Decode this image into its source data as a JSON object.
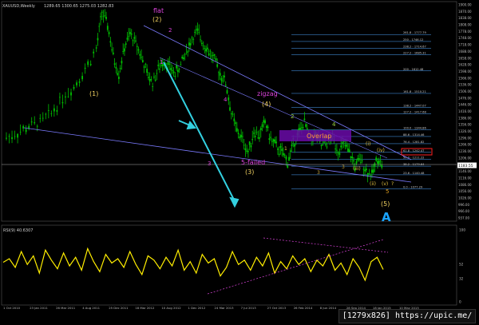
{
  "symbol": "XAUUSD,Weekly",
  "ohlc_text": "1289.65 1300.65 1275.03 1282.83",
  "indicator_label": "RSI(9) 40.6307",
  "watermark": "[1279x826] https://upic.me/",
  "colors": {
    "background": "#000000",
    "candle": "#00c000",
    "channel": "#7b7bff",
    "arrow": "#33d0e0",
    "wave_main": "#f0d060",
    "wave_sub": "#dd44dd",
    "overlap_box": "#6a0ba8",
    "rsi": "#ffee00",
    "fib_line": "#4da6ff",
    "highlight_box": "#ff2020",
    "level_A": "#1aa3ff"
  },
  "chart_data": {
    "type": "line",
    "title": "",
    "x_tick_labels": [
      "1 Oct 2010",
      "23 Jan 2011",
      "26 Mar 2011",
      "4 Aug 2011",
      "25 Dec 2011",
      "18 Mar 2012",
      "10 Aug 2012",
      "1 Dec 2012",
      "24 Mar 2013",
      "7 Jul 2013",
      "27 Oct 2013",
      "26 Feb 2014",
      "8 Jun 2014",
      "28 Sep 2014",
      "18 Jan 2015",
      "10 May 2015"
    ],
    "y_tick_labels": [
      "1900.00",
      "1870.00",
      "1838.00",
      "1808.00",
      "1778.00",
      "1748.00",
      "1718.00",
      "1688.00",
      "1658.00",
      "1628.00",
      "1598.00",
      "1566.00",
      "1536.00",
      "1506.00",
      "1476.00",
      "1446.00",
      "1416.00",
      "1386.00",
      "1356.00",
      "1326.00",
      "1296.00",
      "1266.00",
      "1236.00",
      "1206.00",
      "1176.00",
      "1146.00",
      "1116.00",
      "1086.00",
      "1056.00",
      "1026.00",
      "996.00",
      "966.00",
      "937.00"
    ],
    "y_range": [
      937,
      1920
    ],
    "price_series": [
      {
        "x": 0,
        "y": 1310
      },
      {
        "x": 2,
        "y": 1330
      },
      {
        "x": 4,
        "y": 1360
      },
      {
        "x": 6,
        "y": 1380
      },
      {
        "x": 8,
        "y": 1420
      },
      {
        "x": 10,
        "y": 1490
      },
      {
        "x": 12,
        "y": 1540
      },
      {
        "x": 14,
        "y": 1620
      },
      {
        "x": 16,
        "y": 1710
      },
      {
        "x": 17,
        "y": 1880
      },
      {
        "x": 18,
        "y": 1820
      },
      {
        "x": 19,
        "y": 1680
      },
      {
        "x": 20,
        "y": 1600
      },
      {
        "x": 21,
        "y": 1720
      },
      {
        "x": 22,
        "y": 1780
      },
      {
        "x": 23,
        "y": 1740
      },
      {
        "x": 24,
        "y": 1680
      },
      {
        "x": 25,
        "y": 1600
      },
      {
        "x": 26,
        "y": 1560
      },
      {
        "x": 27,
        "y": 1620
      },
      {
        "x": 28,
        "y": 1660
      },
      {
        "x": 29,
        "y": 1630
      },
      {
        "x": 30,
        "y": 1600
      },
      {
        "x": 31,
        "y": 1640
      },
      {
        "x": 32,
        "y": 1700
      },
      {
        "x": 33,
        "y": 1760
      },
      {
        "x": 34,
        "y": 1790
      },
      {
        "x": 35,
        "y": 1740
      },
      {
        "x": 36,
        "y": 1700
      },
      {
        "x": 37,
        "y": 1660
      },
      {
        "x": 38,
        "y": 1600
      },
      {
        "x": 39,
        "y": 1560
      },
      {
        "x": 40,
        "y": 1420
      },
      {
        "x": 41,
        "y": 1340
      },
      {
        "x": 42,
        "y": 1300
      },
      {
        "x": 43,
        "y": 1240
      },
      {
        "x": 44,
        "y": 1340
      },
      {
        "x": 45,
        "y": 1320
      },
      {
        "x": 46,
        "y": 1380
      },
      {
        "x": 47,
        "y": 1300
      },
      {
        "x": 48,
        "y": 1270
      },
      {
        "x": 49,
        "y": 1240
      },
      {
        "x": 50,
        "y": 1200
      },
      {
        "x": 51,
        "y": 1280
      },
      {
        "x": 52,
        "y": 1330
      },
      {
        "x": 53,
        "y": 1380
      },
      {
        "x": 54,
        "y": 1300
      },
      {
        "x": 55,
        "y": 1320
      },
      {
        "x": 56,
        "y": 1270
      },
      {
        "x": 57,
        "y": 1290
      },
      {
        "x": 58,
        "y": 1310
      },
      {
        "x": 59,
        "y": 1250
      },
      {
        "x": 60,
        "y": 1280
      },
      {
        "x": 61,
        "y": 1240
      },
      {
        "x": 62,
        "y": 1180
      },
      {
        "x": 63,
        "y": 1210
      },
      {
        "x": 64,
        "y": 1160
      },
      {
        "x": 65,
        "y": 1140
      },
      {
        "x": 66,
        "y": 1220
      },
      {
        "x": 67,
        "y": 1180
      }
    ],
    "rsi_series": [
      55,
      60,
      48,
      70,
      52,
      64,
      40,
      72,
      58,
      46,
      68,
      50,
      62,
      44,
      74,
      56,
      42,
      66,
      54,
      60,
      48,
      70,
      52,
      38,
      64,
      58,
      46,
      62,
      50,
      72,
      44,
      56,
      40,
      66,
      54,
      60,
      36,
      48,
      70,
      52,
      58,
      44,
      62,
      50,
      68,
      40,
      56,
      46,
      64,
      52,
      60,
      42,
      58,
      50,
      66,
      44,
      54,
      38,
      60,
      48,
      30,
      56,
      62,
      45
    ],
    "rsi_range": [
      0,
      100
    ],
    "rsi_tick_labels": [
      "100",
      "52",
      "32",
      "0"
    ],
    "fib_levels": [
      "261.8 - 1777.79",
      "250 - 1746.12",
      "238.2 - 1714.67",
      "227.2 - 1685.31",
      "200 - 1612.48",
      "161.8 - 1510.21",
      "138.2 - 1447.07",
      "127.2 - 1417.68",
      "100.0 - 1344.86",
      "88.6 - 1314.46",
      "76.4 - 1281.82",
      "61.8 - 1242.47",
      "50.0 - 1211.22",
      "38.2 - 1179.64",
      "23.6 - 1140.48",
      "0.0 - 1077.29"
    ],
    "current_price": "1183.55",
    "wave_labels_main": [
      "(1)",
      "(2)",
      "(3)",
      "(4)",
      "(5)"
    ],
    "wave_labels_sub": [
      "1",
      "2",
      "3",
      "4",
      "5-failed"
    ],
    "wave_labels_minor": [
      "1",
      "2",
      "3",
      "4",
      "(i)",
      "(ii)",
      "(iii)",
      "(iv)",
      "(v)",
      "5",
      "?"
    ],
    "annotations": [
      "flat",
      "zigzag",
      "Overlap",
      "A",
      "3"
    ]
  }
}
